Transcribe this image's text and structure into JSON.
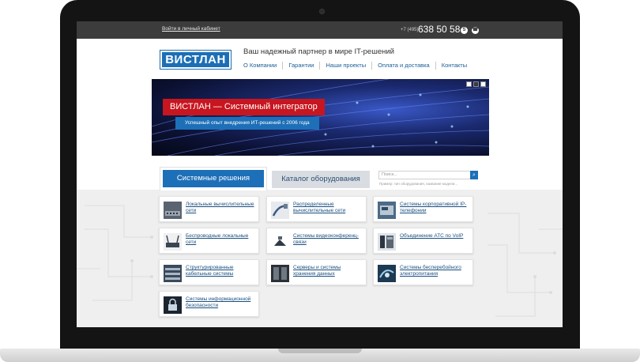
{
  "topbar": {
    "login_link": "Войти в личный кабинет",
    "phone_code": "+7 (495)",
    "phone_number": "638 50 58",
    "icons": [
      "skype-icon",
      "phone-icon"
    ]
  },
  "header": {
    "logo_text": "ВИСТЛАН",
    "tagline": "Ваш надежный партнер в мире IT-решений",
    "nav": [
      "О Компании",
      "Гарантии",
      "Наши проекты",
      "Оплата и доставка",
      "Контакты"
    ]
  },
  "banner": {
    "title": "ВИСТЛАН — Системный интегратор",
    "subtitle": "Успешный опыт внедрения ИТ-решений с 2006 года",
    "slides": 3,
    "active_slide": 2
  },
  "tabs": {
    "active": "Системные решения",
    "inactive": "Каталог оборудования"
  },
  "search": {
    "placeholder": "Поиск...",
    "hint": "Пример: тип оборудования, название модели..."
  },
  "colors": {
    "accent_blue": "#1d6fb8",
    "accent_red": "#c7161f",
    "topbar": "#3c3c3c"
  },
  "solutions": [
    {
      "label": "Локальные вычислительные сети",
      "icon": "network-icon"
    },
    {
      "label": "Распределенные вычислительные сети",
      "icon": "cable-icon"
    },
    {
      "label": "Системы корпоративной IP-телефонии",
      "icon": "telephony-icon"
    },
    {
      "label": "Беспроводные локальные сети",
      "icon": "wireless-icon"
    },
    {
      "label": "Системы видеоконференц-связи",
      "icon": "video-conference-icon"
    },
    {
      "label": "Объединение АТС по VoIP",
      "icon": "voip-icon"
    },
    {
      "label": "Структурированные кабельные системы",
      "icon": "patch-panel-icon"
    },
    {
      "label": "Серверы и системы хранения данных",
      "icon": "server-icon"
    },
    {
      "label": "Системы бесперебойного электропитания",
      "icon": "power-icon"
    },
    {
      "label": "Системы информационной безопасности",
      "icon": "lock-icon"
    }
  ]
}
